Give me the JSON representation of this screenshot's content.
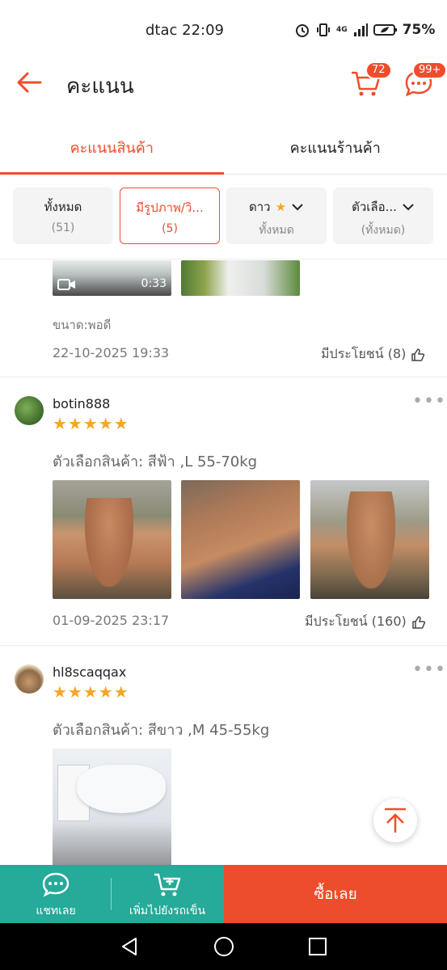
{
  "status_bar": {
    "carrier_time": "dtac 22:09",
    "network": "4G",
    "battery": "75%"
  },
  "header": {
    "title": "คะแนน",
    "cart_count": "72",
    "chat_count": "99+"
  },
  "tabs": [
    {
      "label": "คะแนนสินค้า",
      "active": true
    },
    {
      "label": "คะแนนร้านค้า",
      "active": false
    }
  ],
  "filters": [
    {
      "label": "ทั้งหมด",
      "sub": "(51)"
    },
    {
      "label": "มีรูปภาพ/วิ...",
      "sub": "(5)"
    },
    {
      "label": "ดาว",
      "sub": "ทั้งหมด"
    },
    {
      "label": "ตัวเลือ...",
      "sub": "(ทั้งหมด)"
    }
  ],
  "review0": {
    "video_duration": "0:33",
    "variant": "ขนาด:พอดี",
    "date": "22-10-2025 19:33",
    "helpful": "มีประโยชน์ (8)"
  },
  "review1": {
    "username": "botin888",
    "stars": "★★★★★",
    "variant": "ตัวเลือกสินค้า: สีฟ้า ,L  55-70kg",
    "date": "01-09-2025 23:17",
    "helpful": "มีประโยชน์ (160)"
  },
  "review2": {
    "username": "hl8scaqqax",
    "stars": "★★★★★",
    "variant": "ตัวเลือกสินค้า: สีขาว ,M  45-55kg"
  },
  "more_glyph": "•••",
  "bottom_bar": {
    "chat_label": "แชทเลย",
    "cart_label": "เพิ่มไปยังรถเข็น",
    "buy_label": "ซื้อเลย"
  },
  "colors": {
    "accent": "#ee4d2d",
    "teal": "#26aa99",
    "star": "#f5a623"
  }
}
